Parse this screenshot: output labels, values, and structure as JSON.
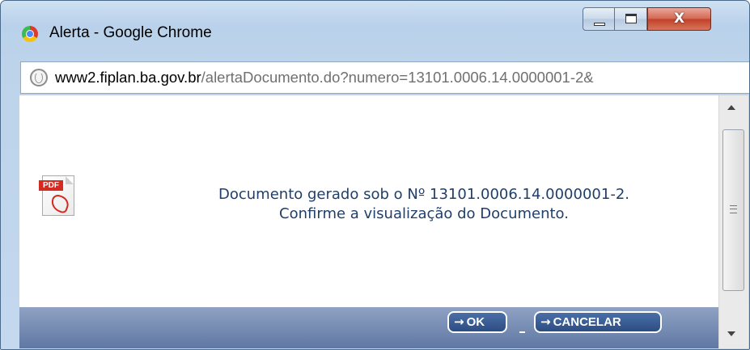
{
  "window": {
    "title": "Alerta - Google Chrome",
    "controls": {
      "minimize_icon": "minimize-icon",
      "maximize_icon": "maximize-icon",
      "close_label": "X"
    }
  },
  "address_bar": {
    "domain": "www2.fiplan.ba.gov.br",
    "path": "/alertaDocumento.do?numero=13101.0006.14.0000001-2&"
  },
  "content": {
    "icon": "pdf-icon",
    "icon_label": "PDF",
    "message_line1": "Documento gerado sob o Nº 13101.0006.14.0000001-2.",
    "message_line2": "Confirme a visualização do Documento."
  },
  "footer": {
    "ok_label": "OK",
    "cancel_label": "CANCELAR",
    "arrow_glyph": "→",
    "separator": "_"
  },
  "colors": {
    "message_text": "#1f3f6a",
    "footer_bar": "#6e85ae",
    "button_fill": "#2f5289"
  }
}
